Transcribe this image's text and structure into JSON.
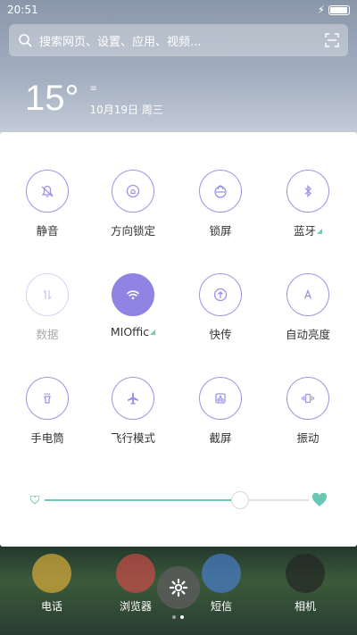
{
  "status": {
    "time": "20:51",
    "battery_percent": 95
  },
  "search": {
    "placeholder": "搜索网页、设置、应用、视频..."
  },
  "weather": {
    "temperature": "15°",
    "date": "10月19日 周三"
  },
  "toggles": [
    {
      "label": "静音",
      "icon": "bell-off-icon",
      "state": "off"
    },
    {
      "label": "方向锁定",
      "icon": "rotation-lock-icon",
      "state": "off"
    },
    {
      "label": "锁屏",
      "icon": "lock-icon",
      "state": "off"
    },
    {
      "label": "蓝牙",
      "icon": "bluetooth-icon",
      "state": "off"
    },
    {
      "label": "数据",
      "icon": "mobile-data-icon",
      "state": "disabled"
    },
    {
      "label": "MIOffic",
      "icon": "wifi-icon",
      "state": "on"
    },
    {
      "label": "快传",
      "icon": "share-icon",
      "state": "off"
    },
    {
      "label": "自动亮度",
      "icon": "auto-brightness-icon",
      "state": "off"
    },
    {
      "label": "手电筒",
      "icon": "flashlight-icon",
      "state": "off"
    },
    {
      "label": "飞行模式",
      "icon": "airplane-icon",
      "state": "off"
    },
    {
      "label": "截屏",
      "icon": "screenshot-icon",
      "state": "off"
    },
    {
      "label": "振动",
      "icon": "vibrate-icon",
      "state": "off"
    }
  ],
  "brightness": {
    "level": 0.74
  },
  "dock": [
    {
      "label": "电话"
    },
    {
      "label": "浏览器"
    },
    {
      "label": "短信"
    },
    {
      "label": "相机"
    }
  ],
  "colors": {
    "accent": "#8f84e3",
    "slider": "#6bc7b5"
  }
}
